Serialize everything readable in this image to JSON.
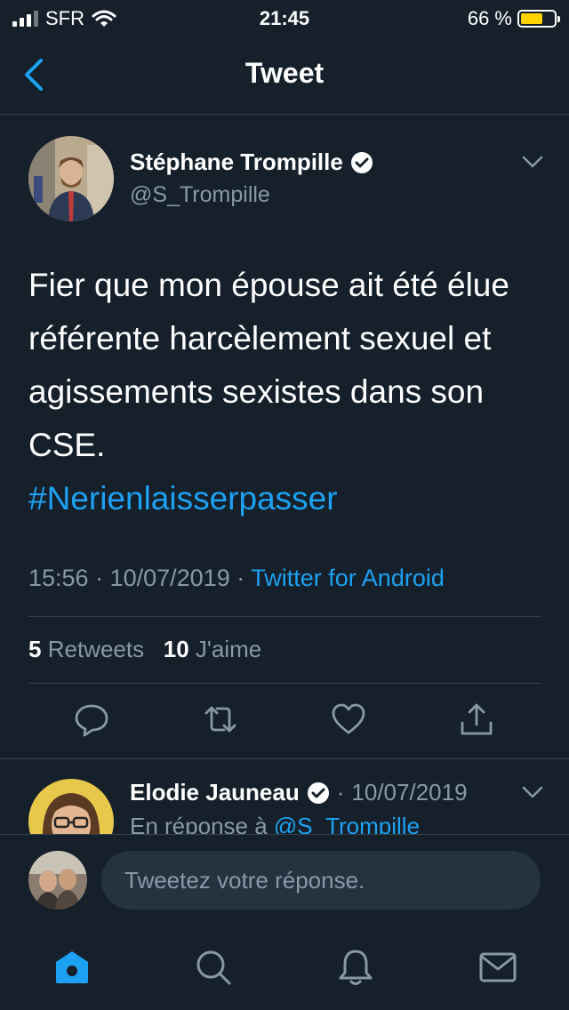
{
  "status_bar": {
    "carrier": "SFR",
    "time": "21:45",
    "battery": "66 %",
    "battery_level": 0.66
  },
  "nav": {
    "title": "Tweet"
  },
  "tweet": {
    "author_name": "Stéphane Trompille",
    "author_handle": "@S_Trompille",
    "text_lines": [
      "Fier que mon épouse ait été élue",
      "référente harcèlement sexuel et",
      "agissements sexistes dans son",
      "CSE."
    ],
    "hashtag": "#Nerienlaisserpasser",
    "time": "15:56",
    "date": "10/07/2019",
    "source": "Twitter for Android",
    "retweets_count": "5",
    "retweets_label": "Retweets",
    "likes_count": "10",
    "likes_label": "J'aime"
  },
  "reply": {
    "author_name": "Elodie Jauneau",
    "date": "10/07/2019",
    "in_reply_prefix": "En réponse à",
    "in_reply_handle": "@S_Trompille"
  },
  "composer": {
    "placeholder": "Tweetez votre réponse."
  },
  "icons": {
    "back": "chevron-left-icon",
    "verified": "verified-badge-icon",
    "caret": "chevron-down-icon",
    "reply": "reply-icon",
    "retweet": "retweet-icon",
    "like": "heart-icon",
    "share": "share-icon",
    "home": "home-icon",
    "search": "search-icon",
    "notifications": "bell-icon",
    "messages": "mail-icon"
  },
  "colors": {
    "background": "#15202b",
    "accent": "#1da1f2",
    "muted": "#8899a6",
    "divider": "#38444d",
    "battery": "#ffd400"
  }
}
